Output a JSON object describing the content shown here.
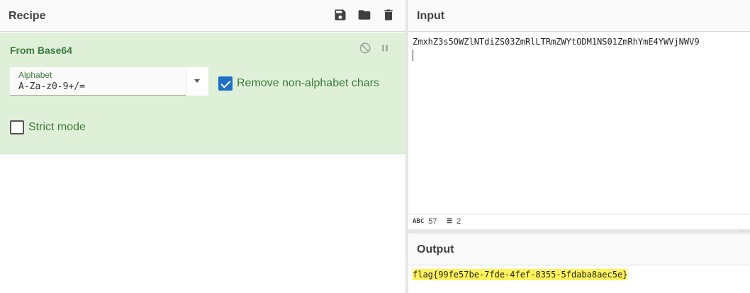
{
  "recipe": {
    "title": "Recipe",
    "icons": [
      "save-icon",
      "folder-icon",
      "trash-icon"
    ]
  },
  "operation": {
    "name": "From Base64",
    "disable_icon": "disable-icon",
    "pause_icon": "pause-icon",
    "alphabet": {
      "label": "Alphabet",
      "value": "A-Za-z0-9+/="
    },
    "remove_non_alphabet": {
      "label": "Remove non-alphabet chars",
      "checked": true
    },
    "strict_mode": {
      "label": "Strict mode",
      "checked": false
    }
  },
  "input": {
    "title": "Input",
    "text": "ZmxhZ3s5OWZlNTdiZS03ZmRlLTRmZWYtODM1NS01ZmRhYmE4YWVjNWV9",
    "stats": {
      "length": "57",
      "lines": "2"
    }
  },
  "output": {
    "title": "Output",
    "text": "flag{99fe57be-7fde-4fef-8355-5fdaba8aec5e}",
    "highlight_color": "#fff35a"
  },
  "colors": {
    "operation_bg": "#dff0d8",
    "operation_text": "#3c7b3c",
    "checkbox_checked": "#1e6fc6"
  }
}
